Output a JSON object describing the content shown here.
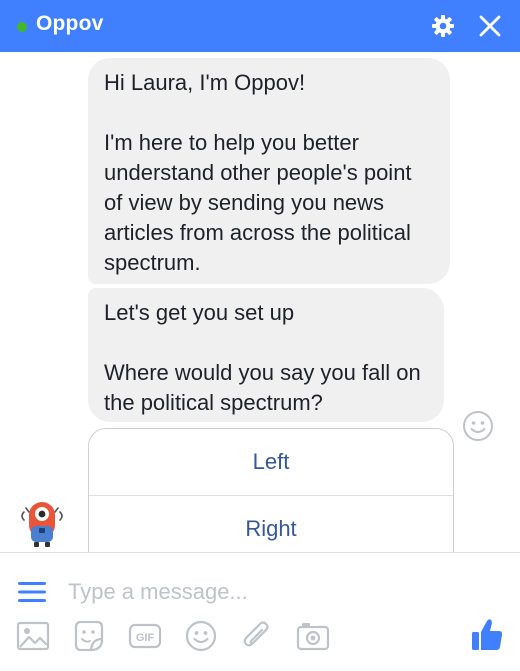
{
  "header": {
    "title": "Oppov",
    "status": "online"
  },
  "messages": [
    {
      "sender": "Oppov",
      "text": "Hi Laura, I'm Oppov!\n\nI'm here to help you better understand other people's point of view by sending you news articles from across the political spectrum."
    },
    {
      "sender": "Oppov",
      "text": "Let's get you set up\n\nWhere would you say you fall on the political spectrum?"
    }
  ],
  "quick_replies": [
    "Left",
    "Right"
  ],
  "composer": {
    "placeholder": "Type a message...",
    "tools": [
      "image-icon",
      "sticker-icon",
      "gif-icon",
      "emoji-icon",
      "attachment-icon",
      "camera-icon"
    ],
    "gif_label": "GIF"
  },
  "colors": {
    "header": "#4080ff",
    "online": "#42b72a",
    "bubble": "#f1f0f0",
    "quick_reply_text": "#365899",
    "icon": "#4080ff"
  }
}
